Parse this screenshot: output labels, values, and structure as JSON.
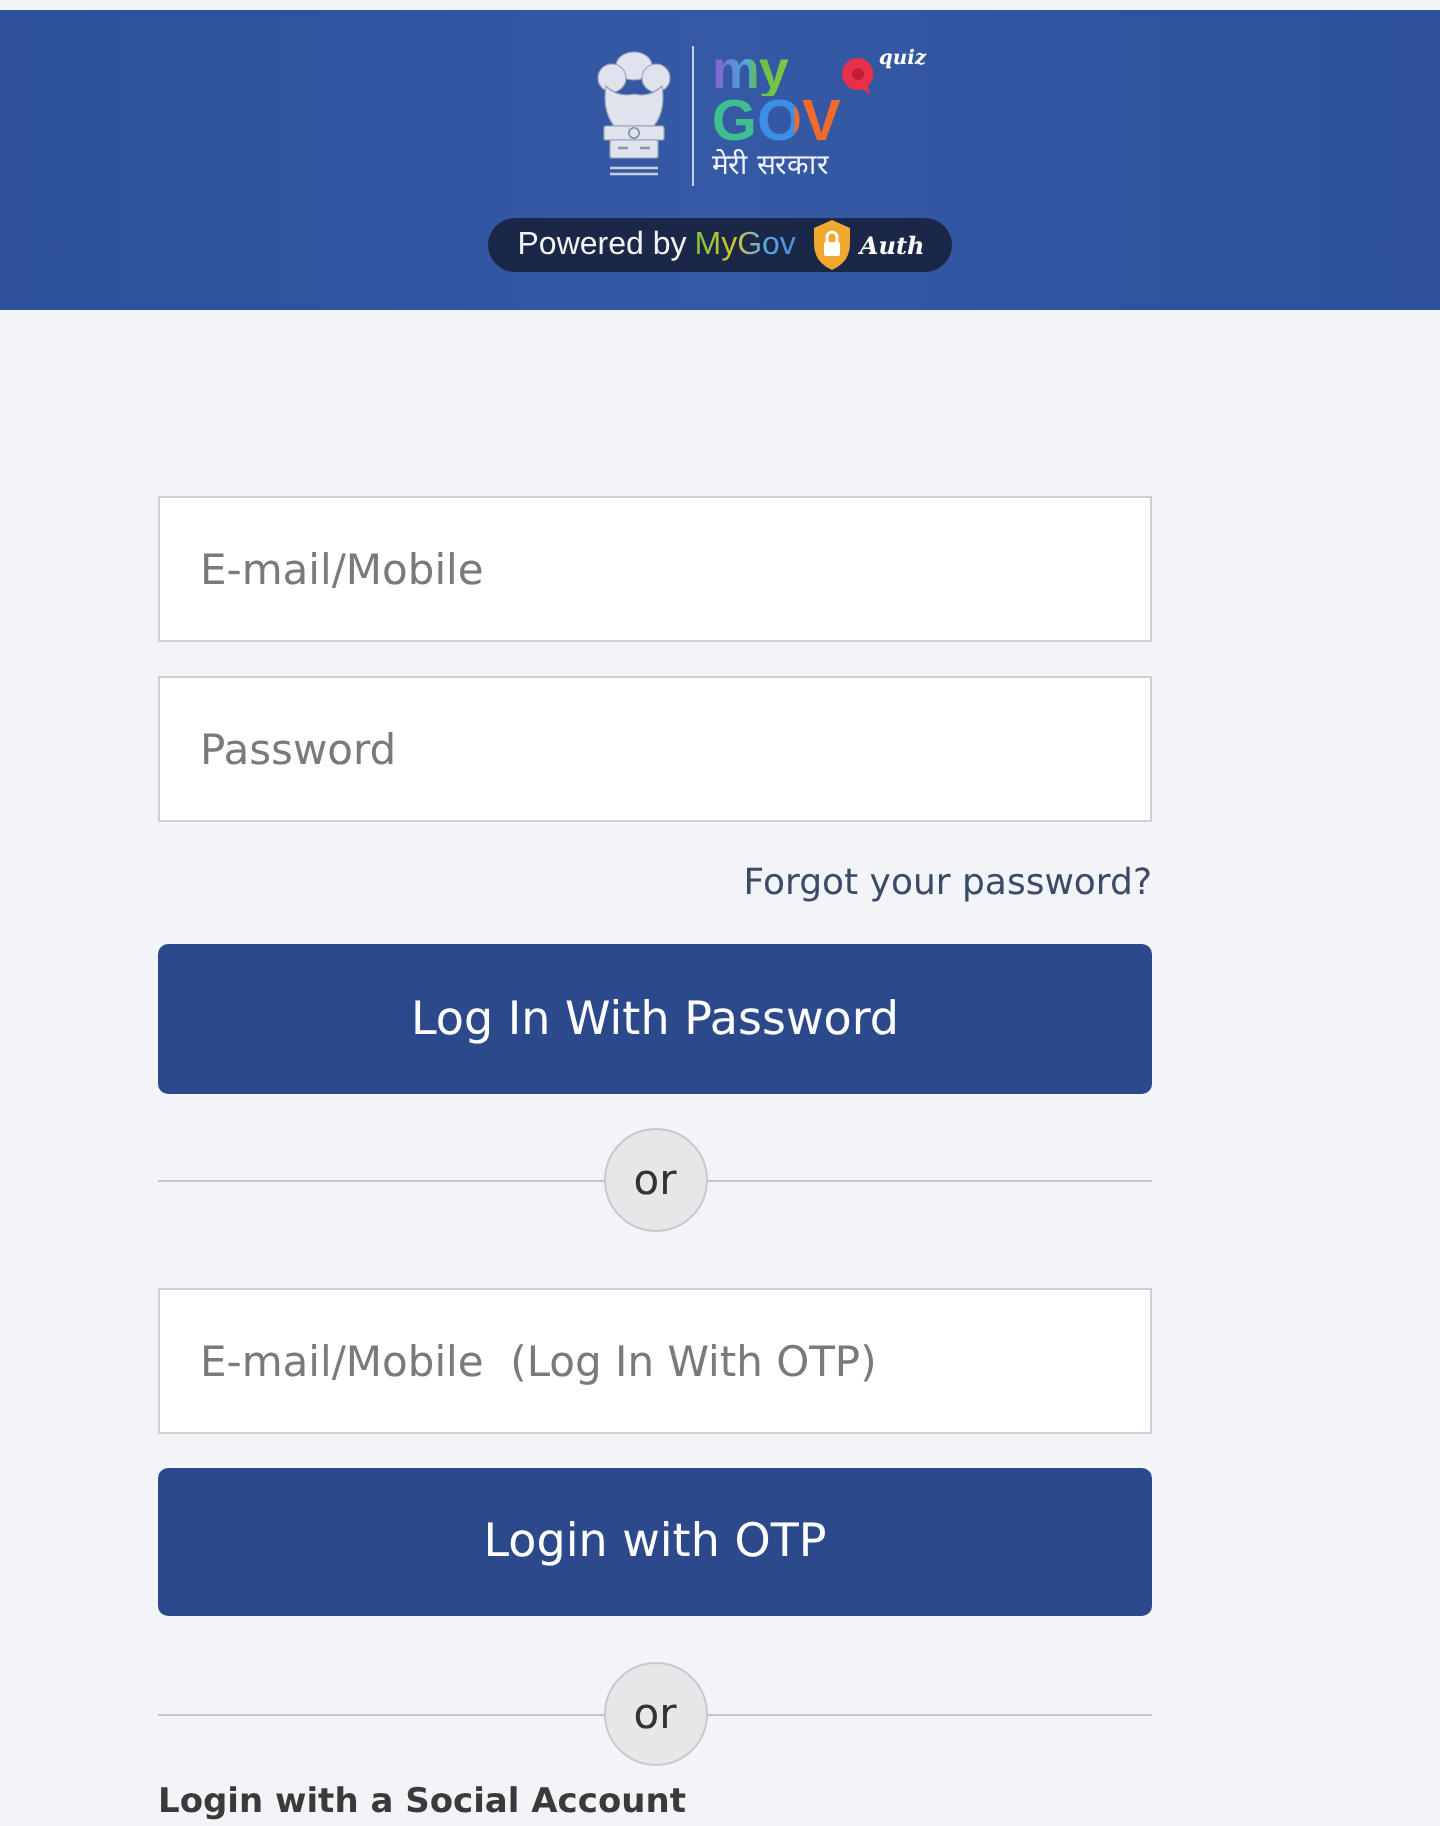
{
  "header": {
    "logo": {
      "line_1": "my",
      "line_2": "GOV",
      "tagline": "मेरी सरकार",
      "badge": "quiz"
    },
    "powered_by": {
      "label": "Powered by",
      "brand": "MyGov",
      "suffix": "Auth"
    }
  },
  "form": {
    "email_field": {
      "placeholder": "E-mail/Mobile"
    },
    "password_field": {
      "placeholder": "Password"
    },
    "forgot_link": "Forgot your password?",
    "password_button": "Log In With Password",
    "divider_1": "or",
    "otp_field": {
      "placeholder": "E-mail/Mobile  (Log In With OTP)"
    },
    "otp_button": "Login with OTP",
    "divider_2": "or",
    "social_heading": "Login with a Social Account"
  }
}
